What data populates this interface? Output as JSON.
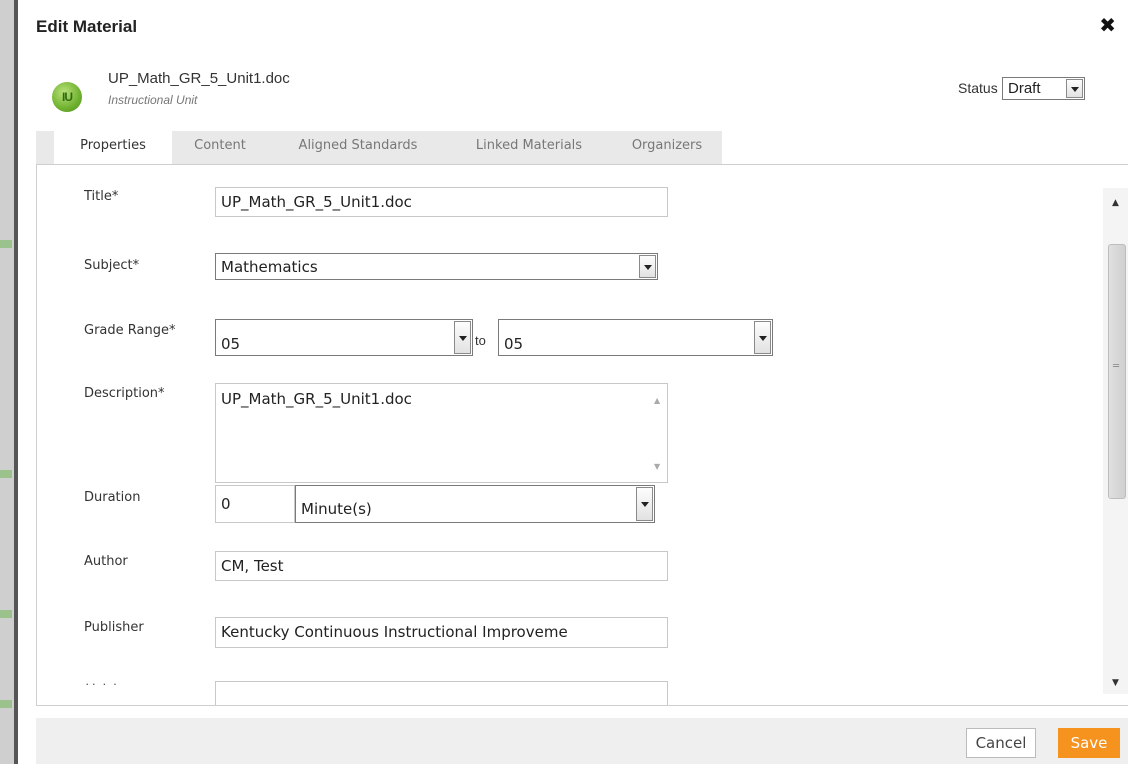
{
  "header": {
    "title": "Edit Material",
    "close_icon": "close-icon"
  },
  "material": {
    "icon_text": "IU",
    "name": "UP_Math_GR_5_Unit1.doc",
    "type": "Instructional Unit"
  },
  "status": {
    "label": "Status",
    "value": "Draft"
  },
  "tabs": [
    {
      "label": "Properties",
      "active": true
    },
    {
      "label": "Content"
    },
    {
      "label": "Aligned Standards"
    },
    {
      "label": "Linked Materials"
    },
    {
      "label": "Organizers"
    }
  ],
  "form": {
    "title": {
      "label": "Title*",
      "value": "UP_Math_GR_5_Unit1.doc"
    },
    "subject": {
      "label": "Subject*",
      "value": "Mathematics"
    },
    "grade_range": {
      "label": "Grade Range*",
      "from": "05",
      "to_text": "to",
      "to": "05"
    },
    "description": {
      "label": "Description*",
      "value": "UP_Math_GR_5_Unit1.doc"
    },
    "duration": {
      "label": "Duration",
      "value": "0",
      "unit": "Minute(s)"
    },
    "author": {
      "label": "Author",
      "value": "CM, Test"
    },
    "publisher": {
      "label": "Publisher",
      "value": "Kentucky Continuous Instructional Improveme"
    }
  },
  "footer": {
    "cancel": "Cancel",
    "save": "Save"
  },
  "colors": {
    "save_button": "#f6921e",
    "tab_bar": "#e9e9e9",
    "footer": "#efefef"
  }
}
